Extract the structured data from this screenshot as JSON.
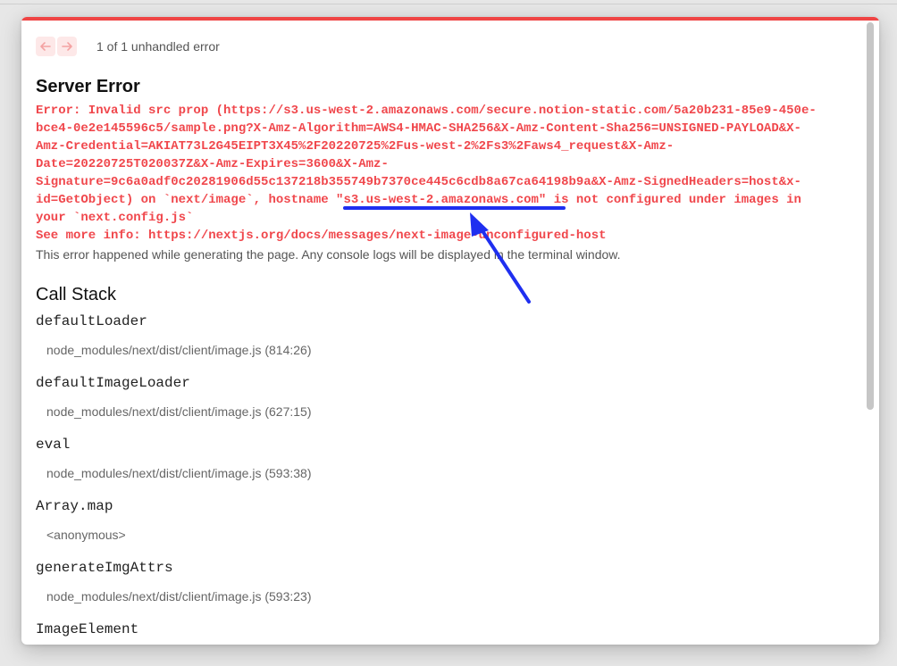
{
  "nav": {
    "prev_icon": "arrow-left-icon",
    "next_icon": "arrow-right-icon",
    "error_count": "1 of 1 unhandled error"
  },
  "title": "Server Error",
  "error_lines": [
    "Error: Invalid src prop (https://s3.us-west-2.amazonaws.com/secure.notion-static.com/5a20b231-85e9-450e-",
    "bce4-0e2e145596c5/sample.png?X-Amz-Algorithm=AWS4-HMAC-SHA256&X-Amz-Content-Sha256=UNSIGNED-PAYLOAD&X-",
    "Amz-Credential=AKIAT73L2G45EIPT3X45%2F20220725%2Fus-west-2%2Fs3%2Faws4_request&X-Amz-",
    "Date=20220725T020037Z&X-Amz-Expires=3600&X-Amz-",
    "Signature=9c6a0adf0c20281906d55c137218b355749b7370ce445c6cdb8a67ca64198b9a&X-Amz-SignedHeaders=host&x-",
    "id=GetObject) on `next/image`, hostname \"s3.us-west-2.amazonaws.com\" is not configured under images in",
    "your `next.config.js`",
    "See more info: https://nextjs.org/docs/messages/next-image-unconfigured-host"
  ],
  "note": "This error happened while generating the page. Any console logs will be displayed in the terminal window.",
  "call_stack": {
    "title": "Call Stack",
    "frames": [
      {
        "fn": "defaultLoader",
        "loc": "node_modules/next/dist/client/image.js (814:26)"
      },
      {
        "fn": "defaultImageLoader",
        "loc": "node_modules/next/dist/client/image.js (627:15)"
      },
      {
        "fn": "eval",
        "loc": "node_modules/next/dist/client/image.js (593:38)"
      },
      {
        "fn": "Array.map",
        "loc": "<anonymous>"
      },
      {
        "fn": "generateImgAttrs",
        "loc": "node_modules/next/dist/client/image.js (593:23)"
      },
      {
        "fn": "ImageElement",
        "loc": ""
      }
    ]
  },
  "colors": {
    "accent": "#ef4444",
    "error_text": "#f0474c",
    "annotation": "#1f2ff0"
  }
}
